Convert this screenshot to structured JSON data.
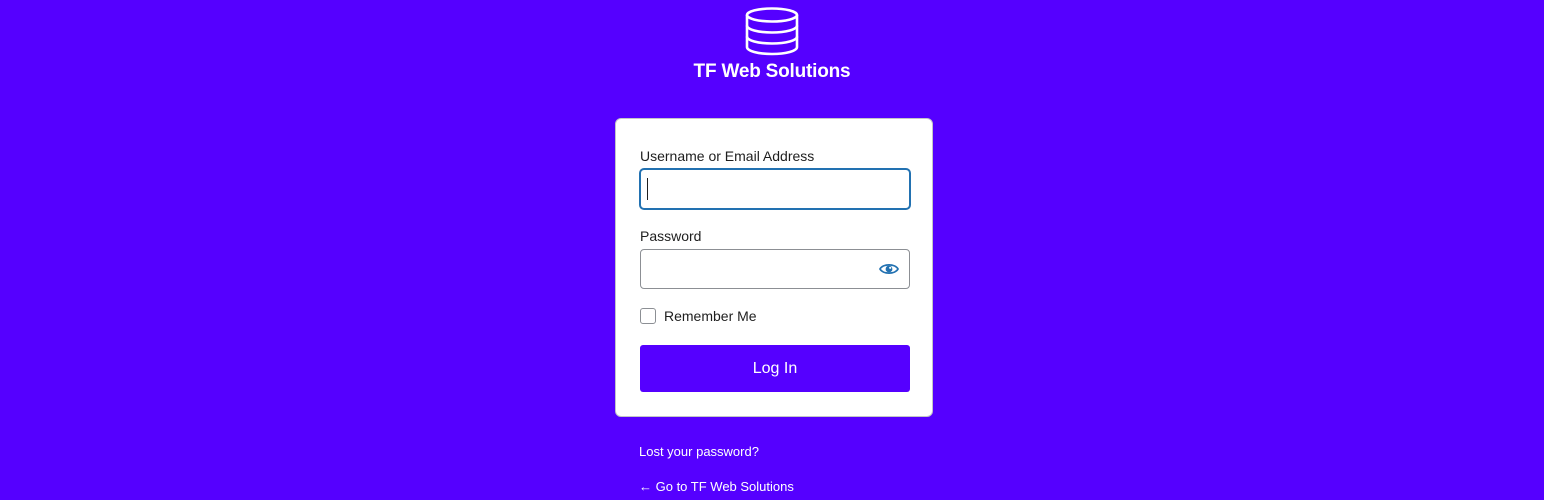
{
  "brand": {
    "name": "TF Web Solutions",
    "logo_icon": "database-icon",
    "background_color": "#5500ff"
  },
  "login_form": {
    "username_label": "Username or Email Address",
    "username_value": "",
    "password_label": "Password",
    "password_value": "",
    "show_password_icon": "eye-icon",
    "remember_label": "Remember Me",
    "remember_checked": false,
    "submit_label": "Log In"
  },
  "links": {
    "lost_password": "Lost your password?",
    "back_to_site": "← Go to TF Web Solutions"
  }
}
